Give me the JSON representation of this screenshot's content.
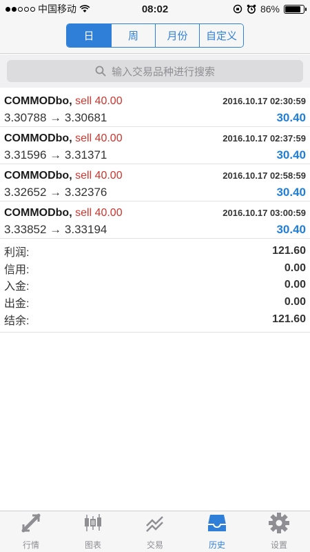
{
  "status_bar": {
    "carrier": "中国移动",
    "time": "08:02",
    "battery": "86%",
    "battery_level": 0.86
  },
  "segments": [
    {
      "label": "日",
      "active": true
    },
    {
      "label": "周",
      "active": false
    },
    {
      "label": "月份",
      "active": false
    },
    {
      "label": "自定义",
      "active": false
    }
  ],
  "search": {
    "placeholder": "输入交易品种进行搜索"
  },
  "trades": [
    {
      "symbol": "COMMODbo,",
      "side": "sell 40.00",
      "time": "2016.10.17 02:30:59",
      "prices": "3.30788 → 3.30681",
      "profit": "30.40"
    },
    {
      "symbol": "COMMODbo,",
      "side": "sell 40.00",
      "time": "2016.10.17 02:37:59",
      "prices": "3.31596 → 3.31371",
      "profit": "30.40"
    },
    {
      "symbol": "COMMODbo,",
      "side": "sell 40.00",
      "time": "2016.10.17 02:58:59",
      "prices": "3.32652 → 3.32376",
      "profit": "30.40"
    },
    {
      "symbol": "COMMODbo,",
      "side": "sell 40.00",
      "time": "2016.10.17 03:00:59",
      "prices": "3.33852 → 3.33194",
      "profit": "30.40"
    }
  ],
  "summary": [
    {
      "label": "利润:",
      "value": "121.60"
    },
    {
      "label": "信用:",
      "value": "0.00"
    },
    {
      "label": "入金:",
      "value": "0.00"
    },
    {
      "label": "出金:",
      "value": "0.00"
    },
    {
      "label": "结余:",
      "value": "121.60"
    }
  ],
  "tabs": [
    {
      "label": "行情",
      "icon": "quotes-icon",
      "active": false
    },
    {
      "label": "图表",
      "icon": "chart-icon",
      "active": false
    },
    {
      "label": "交易",
      "icon": "trade-icon",
      "active": false
    },
    {
      "label": "历史",
      "icon": "history-icon",
      "active": true
    },
    {
      "label": "设置",
      "icon": "gear-icon",
      "active": false
    }
  ],
  "colors": {
    "accent": "#2f7fd8",
    "sell": "#d0342c",
    "profit": "#1f7ed6"
  }
}
